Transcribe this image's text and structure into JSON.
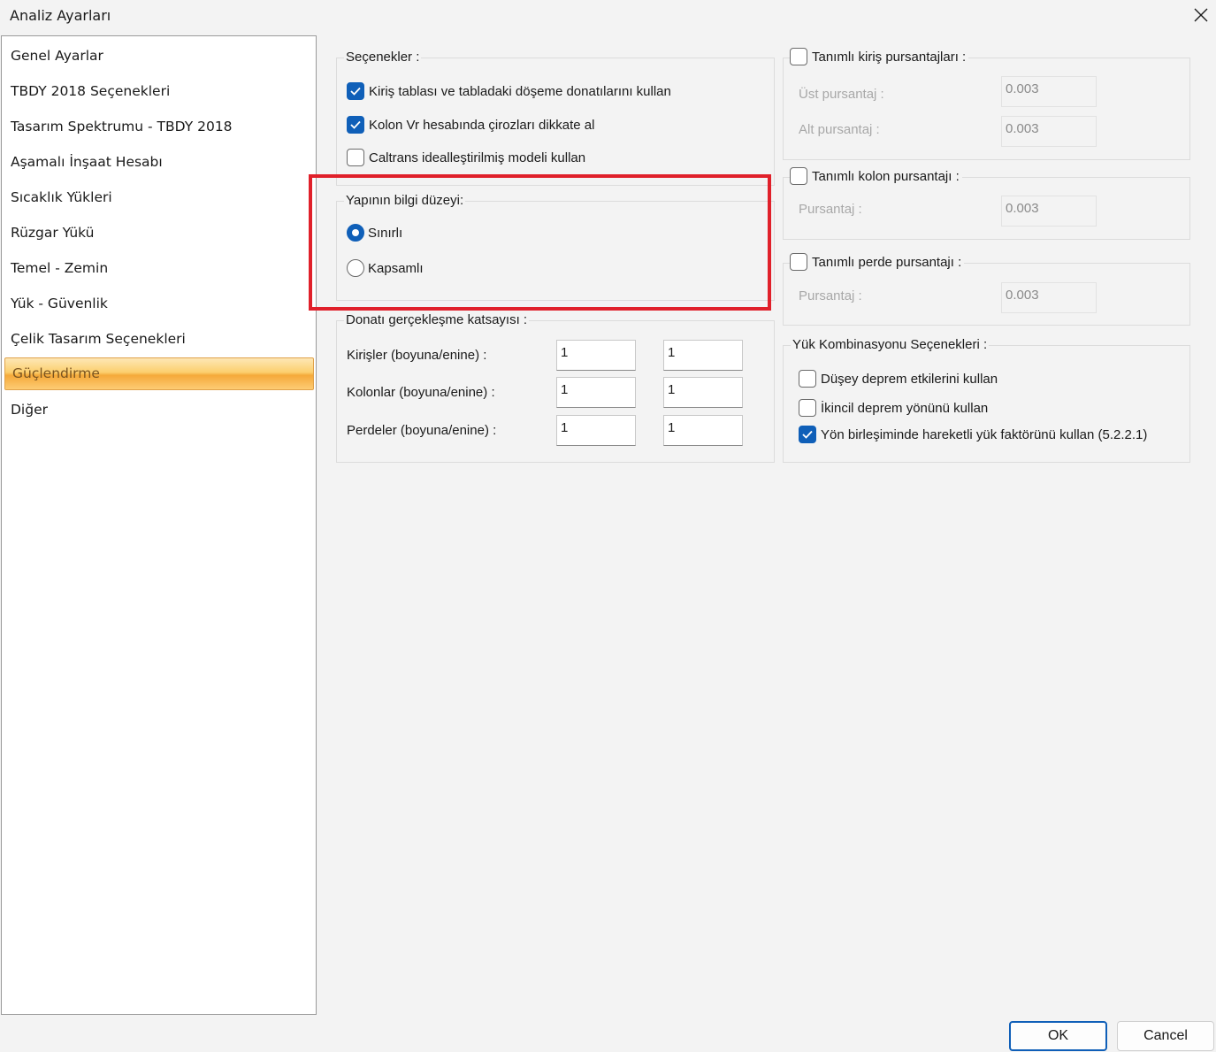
{
  "window": {
    "title": "Analiz Ayarları"
  },
  "sidebar": {
    "items": [
      {
        "label": "Genel Ayarlar"
      },
      {
        "label": "TBDY 2018 Seçenekleri"
      },
      {
        "label": "Tasarım Spektrumu - TBDY 2018"
      },
      {
        "label": "Aşamalı İnşaat Hesabı"
      },
      {
        "label": "Sıcaklık Yükleri"
      },
      {
        "label": "Rüzgar Yükü"
      },
      {
        "label": "Temel - Zemin"
      },
      {
        "label": "Yük - Güvenlik"
      },
      {
        "label": "Çelik Tasarım Seçenekleri"
      },
      {
        "label": "Güçlendirme",
        "selected": true
      },
      {
        "label": "Diğer"
      }
    ]
  },
  "options": {
    "title": "Seçenekler :",
    "items": [
      {
        "label": "Kiriş tablası ve tabladaki döşeme donatılarını kullan",
        "checked": true
      },
      {
        "label": "Kolon Vr hesabında çirozları dikkate al",
        "checked": true
      },
      {
        "label": "Caltrans idealleştirilmiş modeli kullan",
        "checked": false
      }
    ]
  },
  "knowledge": {
    "title": "Yapının bilgi düzeyi:",
    "options": [
      {
        "label": "Sınırlı",
        "selected": true
      },
      {
        "label": "Kapsamlı",
        "selected": false
      }
    ]
  },
  "reinforcement": {
    "title": "Donatı gerçekleşme katsayısı :",
    "rows": [
      {
        "label": "Kirişler (boyuna/enine) :",
        "v1": "1",
        "v2": "1"
      },
      {
        "label": "Kolonlar (boyuna/enine) :",
        "v1": "1",
        "v2": "1"
      },
      {
        "label": "Perdeler (boyuna/enine) :",
        "v1": "1",
        "v2": "1"
      }
    ]
  },
  "beam_ratio": {
    "title": "Tanımlı kiriş pursantajları :",
    "checked": false,
    "top_label": "Üst pursantaj :",
    "top_value": "0.003",
    "bottom_label": "Alt pursantaj :",
    "bottom_value": "0.003"
  },
  "column_ratio": {
    "title": "Tanımlı kolon pursantajı :",
    "checked": false,
    "label": "Pursantaj :",
    "value": "0.003"
  },
  "wall_ratio": {
    "title": "Tanımlı perde pursantajı :",
    "checked": false,
    "label": "Pursantaj :",
    "value": "0.003"
  },
  "load_combo": {
    "title": "Yük Kombinasyonu Seçenekleri :",
    "items": [
      {
        "label": "Düşey deprem etkilerini kullan",
        "checked": false
      },
      {
        "label": "İkincil deprem yönünü kullan",
        "checked": false
      },
      {
        "label": "Yön birleşiminde hareketli yük faktörünü kullan (5.2.2.1)",
        "checked": true
      }
    ]
  },
  "footer": {
    "ok_label": "OK",
    "cancel_label": "Cancel"
  },
  "colors": {
    "accent": "#0f5fb8",
    "highlight": "#e0202a",
    "selected_nav": "#fccf6e"
  }
}
